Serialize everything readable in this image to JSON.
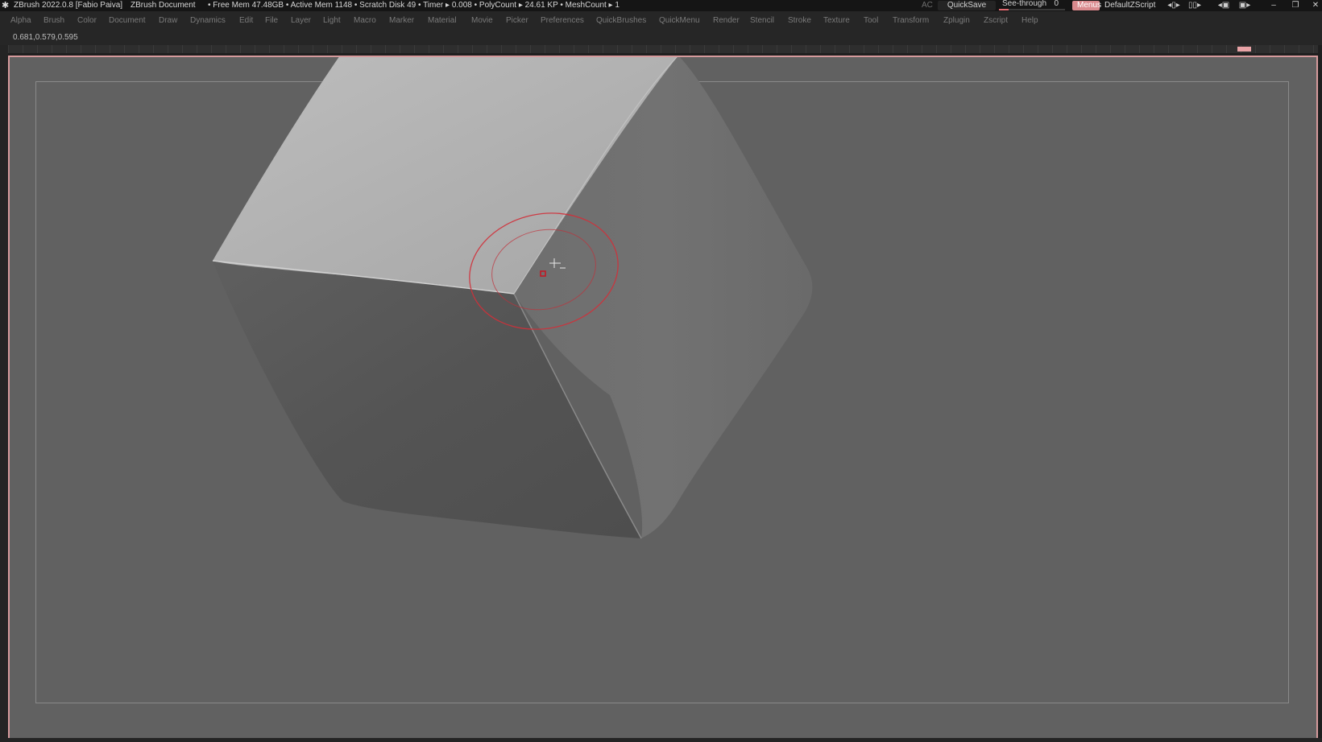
{
  "titlebar": {
    "app_title": "ZBrush 2022.0.8 [Fabio Paiva]",
    "document": "ZBrush Document",
    "stats": "• Free Mem 47.48GB • Active Mem 1148 • Scratch Disk 49 •  Timer ▸ 0.008 • PolyCount ▸ 24.61 KP  • MeshCount ▸ 1",
    "ac": "AC",
    "quicksave": "QuickSave",
    "see_through_label": "See-through",
    "see_through_value": "0",
    "menus": "Menus",
    "script": "DefaultZScript"
  },
  "menubar": {
    "items": [
      "Alpha",
      "Brush",
      "Color",
      "Document",
      "Draw",
      "Dynamics",
      "Edit",
      "File",
      "Layer",
      "Light",
      "Macro",
      "Marker",
      "Material",
      "Movie",
      "Picker",
      "Preferences",
      "QuickBrushes",
      "QuickMenu",
      "Render",
      "Stencil",
      "Stroke",
      "Texture",
      "Tool",
      "Transform",
      "Zplugin",
      "Zscript",
      "Help"
    ]
  },
  "infobar": {
    "coords": "0.681,0.579,0.595"
  },
  "colors": {
    "accent": "#d98a8e",
    "brush_circle": "#d0303a",
    "canvas_bg": "#616161"
  },
  "icons": {
    "app": "zbrush-logo-icon",
    "minimize": "minimize-icon",
    "restore": "restore-icon",
    "close": "close-icon"
  }
}
